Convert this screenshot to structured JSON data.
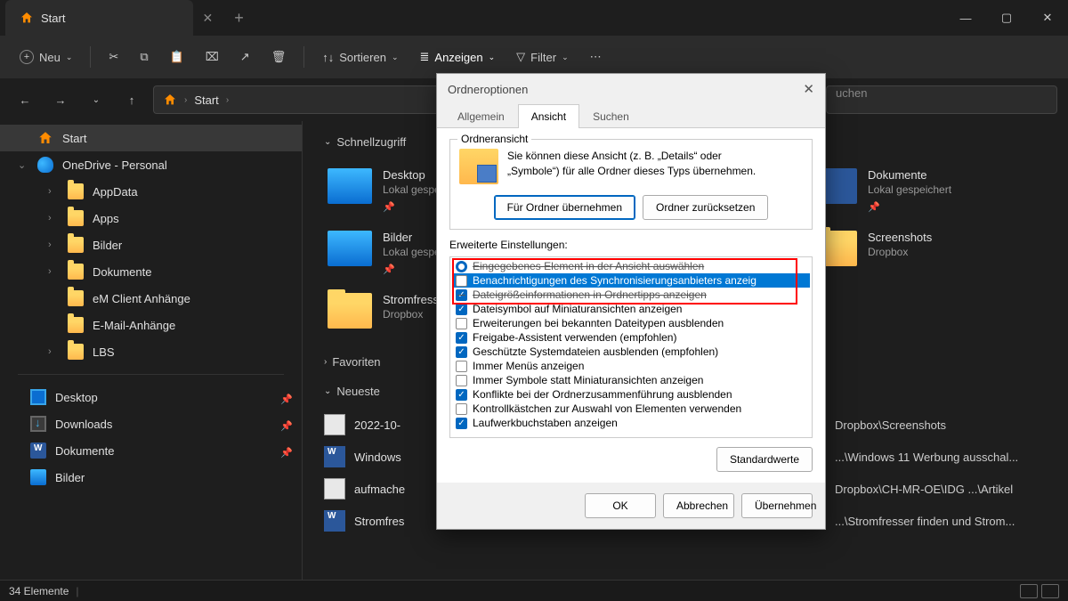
{
  "titlebar": {
    "tab_title": "Start"
  },
  "toolbar": {
    "new_label": "Neu",
    "sort_label": "Sortieren",
    "view_label": "Anzeigen",
    "filter_label": "Filter"
  },
  "addrbar": {
    "crumb1": "Start",
    "search_placeholder": "uchen"
  },
  "sidebar": {
    "items": [
      {
        "label": "Start"
      },
      {
        "label": "OneDrive - Personal"
      },
      {
        "label": "AppData"
      },
      {
        "label": "Apps"
      },
      {
        "label": "Bilder"
      },
      {
        "label": "Dokumente"
      },
      {
        "label": "eM Client Anhänge"
      },
      {
        "label": "E-Mail-Anhänge"
      },
      {
        "label": "LBS"
      }
    ],
    "items2": [
      {
        "label": "Desktop"
      },
      {
        "label": "Downloads"
      },
      {
        "label": "Dokumente"
      },
      {
        "label": "Bilder"
      }
    ]
  },
  "main": {
    "quick_label": "Schnellzugriff",
    "favs_label": "Favoriten",
    "recent_label": "Neueste",
    "tiles": [
      {
        "name": "Desktop",
        "sub": "Lokal gespeichert"
      },
      {
        "name": "Dokumente",
        "sub": "Lokal gespeichert"
      },
      {
        "name": "Bilder",
        "sub": "Lokal gespeichert"
      },
      {
        "name": "Screenshots",
        "sub": "Dropbox"
      },
      {
        "name": "Stromfresser",
        "sub": "Dropbox"
      }
    ],
    "files": [
      {
        "name": "2022-10-",
        "path": "Dropbox\\Screenshots"
      },
      {
        "name": "Windows",
        "path": "...\\Windows 11 Werbung ausschal..."
      },
      {
        "name": "aufmache",
        "path": "Dropbox\\CH-MR-OE\\IDG ...\\Artikel"
      },
      {
        "name": "Stromfres",
        "path": "...\\Stromfresser finden und Strom..."
      }
    ]
  },
  "status": {
    "count_label": "34 Elemente"
  },
  "dialog": {
    "title": "Ordneroptionen",
    "tabs": {
      "t1": "Allgemein",
      "t2": "Ansicht",
      "t3": "Suchen"
    },
    "folder_view": {
      "legend": "Ordneransicht",
      "text_l1": "Sie können diese Ansicht (z. B. „Details“ oder",
      "text_l2": "„Symbole“) für alle Ordner dieses Typs übernehmen.",
      "btn_apply": "Für Ordner übernehmen",
      "btn_reset": "Ordner zurücksetzen"
    },
    "adv_legend": "Erweiterte Einstellungen:",
    "options": [
      {
        "kind": "radio",
        "checked": true,
        "strike": true,
        "label": "Eingegebenes Element in der Ansicht auswählen"
      },
      {
        "kind": "check",
        "checked": false,
        "sel": true,
        "label": "Benachrichtigungen des Synchronisierungsanbieters anzeig"
      },
      {
        "kind": "check",
        "checked": true,
        "strike": true,
        "label": "Dateigrößeinformationen in Ordnertipps anzeigen"
      },
      {
        "kind": "check",
        "checked": true,
        "label": "Dateisymbol auf Miniaturansichten anzeigen"
      },
      {
        "kind": "check",
        "checked": false,
        "label": "Erweiterungen bei bekannten Dateitypen ausblenden"
      },
      {
        "kind": "check",
        "checked": true,
        "label": "Freigabe-Assistent verwenden (empfohlen)"
      },
      {
        "kind": "check",
        "checked": true,
        "label": "Geschützte Systemdateien ausblenden (empfohlen)"
      },
      {
        "kind": "check",
        "checked": false,
        "label": "Immer Menüs anzeigen"
      },
      {
        "kind": "check",
        "checked": false,
        "label": "Immer Symbole statt Miniaturansichten anzeigen"
      },
      {
        "kind": "check",
        "checked": true,
        "label": "Konflikte bei der Ordnerzusammenführung ausblenden"
      },
      {
        "kind": "check",
        "checked": false,
        "label": "Kontrollkästchen zur Auswahl von Elementen verwenden"
      },
      {
        "kind": "check",
        "checked": true,
        "label": "Laufwerkbuchstaben anzeigen"
      }
    ],
    "btn_defaults": "Standardwerte",
    "btn_ok": "OK",
    "btn_cancel": "Abbrechen",
    "btn_apply_dlg": "Übernehmen"
  }
}
